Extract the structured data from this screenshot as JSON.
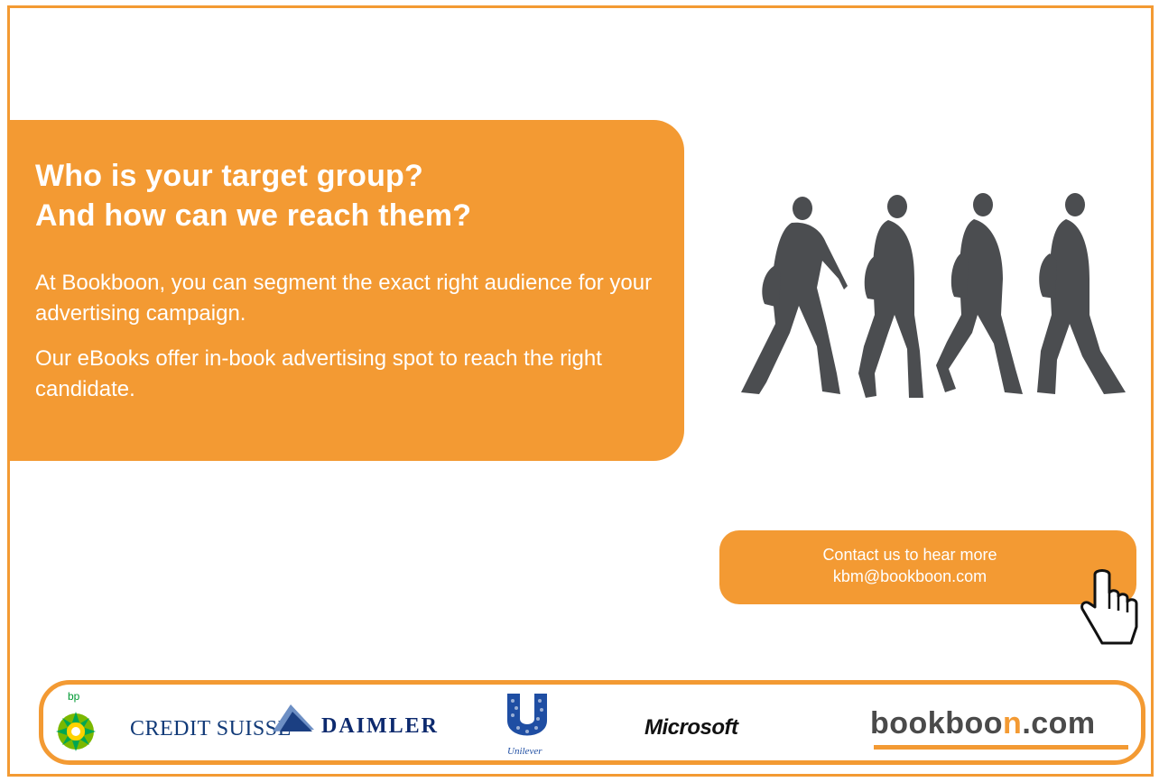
{
  "hero": {
    "headline_line1": "Who is your target group?",
    "headline_line2": "And how can we reach them?",
    "paragraph1": "At Bookboon, you can segment the exact right audience for your advertising campaign.",
    "paragraph2": "Our eBooks offer in-book advertising spot to reach the right candidate."
  },
  "cta": {
    "line1": "Contact us to hear more",
    "line2": "kbm@bookboon.com"
  },
  "logos": {
    "bp": "bp",
    "credit_suisse": "CREDIT SUISSE",
    "daimler": "DAIMLER",
    "unilever": "Unilever",
    "microsoft": "Microsoft",
    "bookboon_prefix": "bookboo",
    "bookboon_accent": "n",
    "bookboon_suffix": ".com"
  },
  "icons": [
    "walking-people-illustration",
    "pointing-hand-cursor-icon",
    "bp-helios-logo",
    "credit-suisse-sail-logo",
    "unilever-u-logo"
  ],
  "colors": {
    "brand_orange": "#f39a33",
    "silhouette_gray": "#4b4d50"
  }
}
